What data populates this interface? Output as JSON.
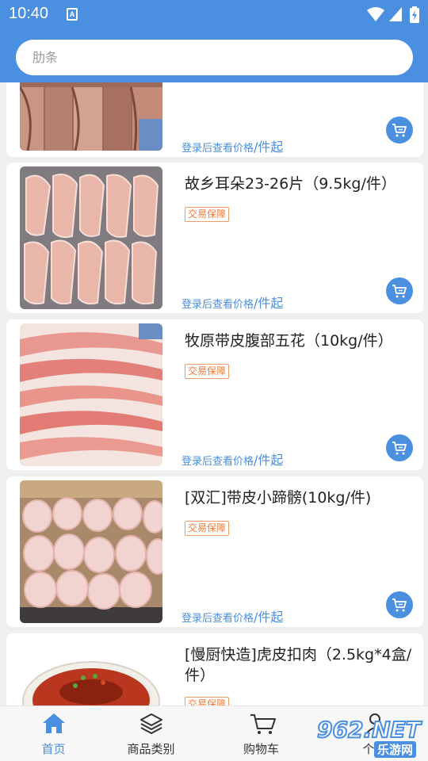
{
  "status_bar": {
    "time": "10:40",
    "notif_letter": "A"
  },
  "search": {
    "placeholder": "肋条"
  },
  "products": [
    {
      "name": "",
      "badge": "",
      "price_note": "登录后查看价格",
      "price_unit": "/件起",
      "image": "pork-ribs-photo"
    },
    {
      "name": "故乡耳朵23-26片（9.5kg/件）",
      "badge": "交易保障",
      "price_note": "登录后查看价格",
      "price_unit": "/件起",
      "image": "pig-ears-photo"
    },
    {
      "name": "牧原带皮腹部五花（10kg/件）",
      "badge": "交易保障",
      "price_note": "登录后查看价格",
      "price_unit": "/件起",
      "image": "pork-belly-photo"
    },
    {
      "name": "[双汇]带皮小蹄髈(10kg/件)",
      "badge": "交易保障",
      "price_note": "登录后查看价格",
      "price_unit": "/件起",
      "image": "pork-knuckle-photo"
    },
    {
      "name": "[慢厨快造]虎皮扣肉（2.5kg*4盒/件）",
      "badge": "交易保障",
      "price_note": "",
      "price_unit": "",
      "image": "braised-pork-photo"
    }
  ],
  "tabs": [
    {
      "label": "首页",
      "icon": "home-icon",
      "active": true
    },
    {
      "label": "商品类别",
      "icon": "layers-icon",
      "active": false
    },
    {
      "label": "购物车",
      "icon": "cart-icon",
      "active": false
    },
    {
      "label": "个人",
      "icon": "person-icon",
      "active": false
    }
  ],
  "watermark": {
    "brand": "962.NET",
    "sub": "乐游网"
  },
  "colors": {
    "primary": "#4a8fe0",
    "badge": "#f07c3c"
  }
}
